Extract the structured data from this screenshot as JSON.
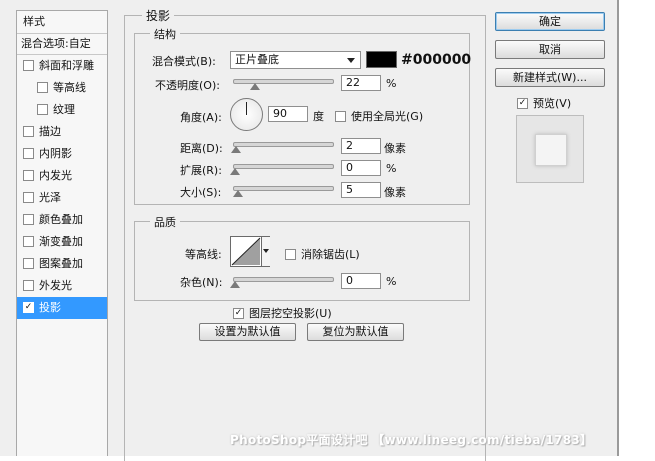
{
  "sidebar": {
    "title": "样式",
    "blend_options": "混合选项:自定",
    "items": [
      {
        "label": "斜面和浮雕",
        "checked": false,
        "indent": false,
        "selected": false
      },
      {
        "label": "等高线",
        "checked": false,
        "indent": true,
        "selected": false
      },
      {
        "label": "纹理",
        "checked": false,
        "indent": true,
        "selected": false
      },
      {
        "label": "描边",
        "checked": false,
        "indent": false,
        "selected": false
      },
      {
        "label": "内阴影",
        "checked": false,
        "indent": false,
        "selected": false
      },
      {
        "label": "内发光",
        "checked": false,
        "indent": false,
        "selected": false
      },
      {
        "label": "光泽",
        "checked": false,
        "indent": false,
        "selected": false
      },
      {
        "label": "颜色叠加",
        "checked": false,
        "indent": false,
        "selected": false
      },
      {
        "label": "渐变叠加",
        "checked": false,
        "indent": false,
        "selected": false
      },
      {
        "label": "图案叠加",
        "checked": false,
        "indent": false,
        "selected": false
      },
      {
        "label": "外发光",
        "checked": false,
        "indent": false,
        "selected": false
      },
      {
        "label": "投影",
        "checked": true,
        "indent": false,
        "selected": true
      }
    ]
  },
  "drop_shadow": {
    "title": "投影",
    "structure": {
      "title": "结构",
      "blend_mode_label": "混合模式(B):",
      "blend_mode_value": "正片叠底",
      "color_hex": "#000000",
      "opacity_label": "不透明度(O):",
      "opacity_value": "22",
      "opacity_unit": "%",
      "opacity_fraction": 0.22,
      "angle_label": "角度(A):",
      "angle_value": "90",
      "angle_unit": "度",
      "global_light_label": "使用全局光(G)",
      "global_light_checked": false,
      "distance_label": "距离(D):",
      "distance_value": "2",
      "distance_unit": "像素",
      "spread_label": "扩展(R):",
      "spread_value": "0",
      "spread_unit": "%",
      "size_label": "大小(S):",
      "size_value": "5",
      "size_unit": "像素"
    },
    "quality": {
      "title": "品质",
      "contour_label": "等高线:",
      "antialias_label": "消除锯齿(L)",
      "antialias_checked": false,
      "noise_label": "杂色(N):",
      "noise_value": "0",
      "noise_unit": "%"
    },
    "knockout_label": "图层挖空投影(U)",
    "knockout_checked": true,
    "make_default_label": "设置为默认值",
    "reset_default_label": "复位为默认值"
  },
  "buttons": {
    "ok": "确定",
    "cancel": "取消",
    "new_style": "新建样式(W)...",
    "preview_label": "预览(V)",
    "preview_checked": true
  },
  "watermark": "PhotoShop平面设计吧 【www.lineeg.com/tieba/1783】",
  "colors": {
    "selection": "#3399ff",
    "dialog_bg": "#efefef",
    "shadow_color": "#000000"
  }
}
